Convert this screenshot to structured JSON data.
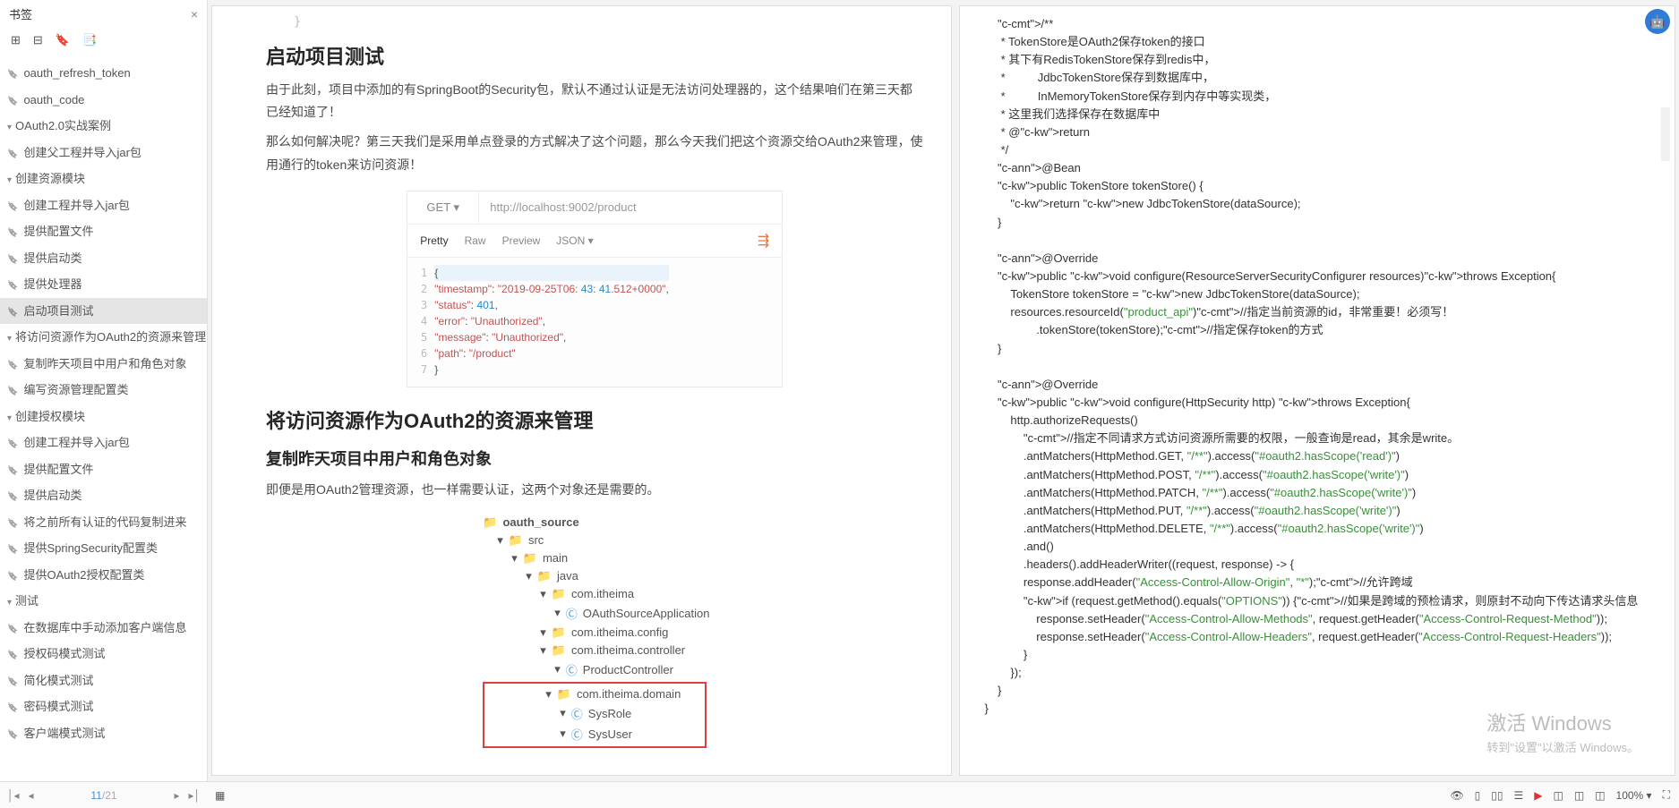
{
  "sidebar": {
    "title": "书签",
    "items": [
      {
        "label": "oauth_refresh_token",
        "cls": "bm ind2"
      },
      {
        "label": "oauth_code",
        "cls": "bm ind2"
      },
      {
        "label": "OAuth2.0实战案例",
        "cls": "hdr ind1"
      },
      {
        "label": "创建父工程并导入jar包",
        "cls": "bm ind2"
      },
      {
        "label": "创建资源模块",
        "cls": "hdr ind2"
      },
      {
        "label": "创建工程并导入jar包",
        "cls": "bm ind3"
      },
      {
        "label": "提供配置文件",
        "cls": "bm ind3"
      },
      {
        "label": "提供启动类",
        "cls": "bm ind3"
      },
      {
        "label": "提供处理器",
        "cls": "bm ind3"
      },
      {
        "label": "启动项目测试",
        "cls": "bm ind3 selected"
      },
      {
        "label": "将访问资源作为OAuth2的资源来管理",
        "cls": "hdr ind3"
      },
      {
        "label": "复制昨天项目中用户和角色对象",
        "cls": "bm ind4"
      },
      {
        "label": "编写资源管理配置类",
        "cls": "bm ind4"
      },
      {
        "label": "创建授权模块",
        "cls": "hdr ind2"
      },
      {
        "label": "创建工程并导入jar包",
        "cls": "bm ind3"
      },
      {
        "label": "提供配置文件",
        "cls": "bm ind3"
      },
      {
        "label": "提供启动类",
        "cls": "bm ind3"
      },
      {
        "label": "将之前所有认证的代码复制进来",
        "cls": "bm ind3"
      },
      {
        "label": "提供SpringSecurity配置类",
        "cls": "bm ind3"
      },
      {
        "label": "提供OAuth2授权配置类",
        "cls": "bm ind3"
      },
      {
        "label": "测试",
        "cls": "hdr ind1"
      },
      {
        "label": "在数据库中手动添加客户端信息",
        "cls": "bm ind2"
      },
      {
        "label": "授权码模式测试",
        "cls": "bm ind2"
      },
      {
        "label": "简化模式测试",
        "cls": "bm ind2"
      },
      {
        "label": "密码模式测试",
        "cls": "bm ind2"
      },
      {
        "label": "客户端模式测试",
        "cls": "bm ind2"
      }
    ]
  },
  "pageL": {
    "h2a": "启动项目测试",
    "p1": "由于此刻，项目中添加的有SpringBoot的Security包，默认不通过认证是无法访问处理器的，这个结果咱们在第三天都已经知道了！",
    "p2": "那么如何解决呢？第三天我们是采用单点登录的方式解决了这个问题，那么今天我们把这个资源交给OAuth2来管理，使用通行的token来访问资源！",
    "pm": {
      "method": "GET  ▾",
      "url": "http://localhost:9002/product",
      "tabs": [
        "Pretty",
        "Raw",
        "Preview",
        "JSON  ▾"
      ],
      "json_lines": [
        "{",
        "    \"timestamp\": \"2019-09-25T06:43:41.512+0000\",",
        "    \"status\": 401,",
        "    \"error\": \"Unauthorized\",",
        "    \"message\": \"Unauthorized\",",
        "    \"path\": \"/product\"",
        "}"
      ]
    },
    "h2b": "将访问资源作为OAuth2的资源来管理",
    "h3": "复制昨天项目中用户和角色对象",
    "p3": "即便是用OAuth2管理资源，也一样需要认证，这两个对象还是需要的。",
    "ftree": {
      "root": "oauth_source",
      "rows": [
        {
          "txt": "src",
          "cls": "ind-b",
          "icon": "📁"
        },
        {
          "txt": "main",
          "cls": "ind-c",
          "icon": "📁"
        },
        {
          "txt": "java",
          "cls": "ind-d",
          "icon": "📁"
        },
        {
          "txt": "com.itheima",
          "cls": "ind-e",
          "icon": "📁"
        },
        {
          "txt": "OAuthSourceApplication",
          "cls": "ind-f",
          "icon": "Ⓒ"
        },
        {
          "txt": "com.itheima.config",
          "cls": "ind-e",
          "icon": "📁"
        },
        {
          "txt": "com.itheima.controller",
          "cls": "ind-e",
          "icon": "📁"
        },
        {
          "txt": "ProductController",
          "cls": "ind-f",
          "icon": "Ⓒ"
        }
      ],
      "boxed": [
        {
          "txt": "com.itheima.domain",
          "cls": "ind-e",
          "icon": "📁"
        },
        {
          "txt": "SysRole",
          "cls": "ind-f",
          "icon": "Ⓒ"
        },
        {
          "txt": "SysUser",
          "cls": "ind-f",
          "icon": "Ⓒ"
        }
      ]
    }
  },
  "pageR": {
    "code": "    /**\n     * TokenStore是OAuth2保存token的接口\n     * 其下有RedisTokenStore保存到redis中，\n     *          JdbcTokenStore保存到数据库中，\n     *          InMemoryTokenStore保存到内存中等实现类，\n     * 这里我们选择保存在数据库中\n     * @return\n     */\n    @Bean\n    public TokenStore tokenStore() {\n        return new JdbcTokenStore(dataSource);\n    }\n\n    @Override\n    public void configure(ResourceServerSecurityConfigurer resources)throws Exception{\n        TokenStore tokenStore = new JdbcTokenStore(dataSource);\n        resources.resourceId(\"product_api\")//指定当前资源的id，非常重要！必须写！\n                .tokenStore(tokenStore);//指定保存token的方式\n    }\n\n    @Override\n    public void configure(HttpSecurity http) throws Exception{\n        http.authorizeRequests()\n            //指定不同请求方式访问资源所需要的权限，一般查询是read，其余是write。\n            .antMatchers(HttpMethod.GET, \"/**\").access(\"#oauth2.hasScope('read')\")\n            .antMatchers(HttpMethod.POST, \"/**\").access(\"#oauth2.hasScope('write')\")\n            .antMatchers(HttpMethod.PATCH, \"/**\").access(\"#oauth2.hasScope('write')\")\n            .antMatchers(HttpMethod.PUT, \"/**\").access(\"#oauth2.hasScope('write')\")\n            .antMatchers(HttpMethod.DELETE, \"/**\").access(\"#oauth2.hasScope('write')\")\n            .and()\n            .headers().addHeaderWriter((request, response) -> {\n            response.addHeader(\"Access-Control-Allow-Origin\", \"*\");//允许跨域\n            if (request.getMethod().equals(\"OPTIONS\")) {//如果是跨域的预检请求，则原封不动向下传达请求头信息\n                response.setHeader(\"Access-Control-Allow-Methods\", request.getHeader(\"Access-Control-Request-Method\"));\n                response.setHeader(\"Access-Control-Allow-Headers\", request.getHeader(\"Access-Control-Request-Headers\"));\n            }\n        });\n    }\n}"
  },
  "footer": {
    "page_cur": "11",
    "page_tot": "/21",
    "zoom": "100%  ▾"
  },
  "watermark": {
    "t": "激活 Windows",
    "s": "转到\"设置\"以激活 Windows。"
  }
}
